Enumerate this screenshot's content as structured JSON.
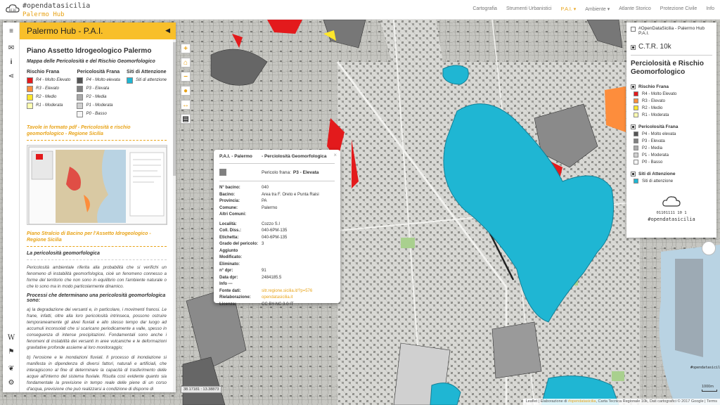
{
  "brand": {
    "line1": "#opendatasicilia",
    "line2": "Palermo Hub"
  },
  "nav": [
    {
      "label": "Cartografia",
      "active": false
    },
    {
      "label": "Strumenti Urbanistici",
      "active": false
    },
    {
      "label": "P.A.I. ▾",
      "active": true
    },
    {
      "label": "Ambiente ▾",
      "active": false
    },
    {
      "label": "Atlante Storico",
      "active": false
    },
    {
      "label": "Protezione Civile",
      "active": false
    },
    {
      "label": "Info",
      "active": false
    }
  ],
  "sidebar": {
    "title": "Palermo Hub - P.A.I.",
    "heading": "Piano Assetto Idrogeologico Palermo",
    "subheading": "Mappa delle Pericolosità e del Rischio Geomorfologico",
    "legend": {
      "rischio": {
        "title": "Rischio Frana",
        "items": [
          {
            "label": "R4 - Molto Elevato",
            "color": "#e31a1c"
          },
          {
            "label": "R3 - Elevato",
            "color": "#fd8d3c"
          },
          {
            "label": "R2 - Medio",
            "color": "#fee62b"
          },
          {
            "label": "R1 - Moderata",
            "color": "#ffffb2"
          }
        ]
      },
      "pericolosita": {
        "title": "Pericolosità Frana",
        "items": [
          {
            "label": "P4 - Molto elevata",
            "color": "#555555"
          },
          {
            "label": "P3 - Elevata",
            "color": "#808080"
          },
          {
            "label": "P2 - Media",
            "color": "#aaaaaa"
          },
          {
            "label": "P1 - Moderata",
            "color": "#d0d0d0"
          },
          {
            "label": "P0 - Basso",
            "color": "#f5f5f5"
          }
        ]
      },
      "siti": {
        "title": "Siti di Attenzione",
        "items": [
          {
            "label": "Siti di attenzione",
            "color": "#1fb6d3"
          }
        ]
      }
    },
    "tavole_link": "Tavole in formato pdf - Pericolosità e rischio geomorfologico - Regione Sicilia",
    "piano_link": "Piano Stralcio di Bacino per l'Assetto Idrogeologico - Regione Sicilia",
    "section_title": "La pericolosità geomorfologica",
    "para1": "Pericolosità ambientale riferita alla probabilità che si verifichi un fenomeno di instabilità geomorfologica, cioè un fenomeno connesso a forme del territorio che non sono in equilibrio con l'ambiente naturale o che lo sono ma in modo particolarmente dinamico.",
    "processes_title": "Processi che determinano una pericolosità geomorfologica sono:",
    "para2": "a) la degradazione dei versanti e, in particolare, i movimenti franosi. Le frane, infatti, oltre alla loro pericolosità intrinseca, possono ostruire temporaneamente gli alvei fluviali e allo stesso tempo dar luogo ad accumuli inconsolati che si scaricano periodicamente a valle, spesso in conseguenza di intense precipitazioni. Fondamentali sono anche i fenomeni di instabilità dei versanti in aree vulcaniche e le deformazioni gravitative profonde assieme al loro monitoraggio;",
    "para3": "b) l'erosione e le inondazioni fluviali. Il processo di inondazione si manifesta in dipendenza di diversi fattori, naturali e artificiali, che interagiscono al fine di determinare la capacità di trasferimento delle acque all'interno del sistema fluviale. Risulta così evidente quanto sia fondamentale la previsione in tempo reale delle piene di un corso d'acqua, previsione che può realizzarsi a condizione di disporre di"
  },
  "popup": {
    "col1": "P.A.I. - Palermo",
    "col2": "- Perciolosità Geomorfologica",
    "class_label": "Pericolo frana:",
    "class_value": "P3 - Elevata",
    "class_color": "#808080",
    "rows1": [
      {
        "k": "N° bacino:",
        "v": "040"
      },
      {
        "k": "Bacino:",
        "v": "Area tra F. Oreto e Punta Raisi"
      },
      {
        "k": "Provincia:",
        "v": "PA"
      },
      {
        "k": "Comune:",
        "v": "Palermo"
      },
      {
        "k": "Altri Comuni:",
        "v": ""
      }
    ],
    "rows2": [
      {
        "k": "Località:",
        "v": "Cozzo S.I"
      },
      {
        "k": "Coll. Diss.:",
        "v": "040-6PM-135"
      },
      {
        "k": "Etichetta:",
        "v": "040-6PM-135"
      },
      {
        "k": "Grado del pericolo:",
        "v": "3"
      },
      {
        "k": "Aggiunto",
        "v": ""
      },
      {
        "k": "Modificato:",
        "v": ""
      },
      {
        "k": "Eliminato:",
        "v": ""
      },
      {
        "k": "n° dpr:",
        "v": "91"
      },
      {
        "k": "Data dpr:",
        "v": "2484185.5"
      },
      {
        "k": "Info ---",
        "v": ""
      },
      {
        "k": "Fonte dati:",
        "v": "sitr.regione.sicilia.it/?p=576",
        "link": true
      },
      {
        "k": "Rielaborazione:",
        "v": "opendatasicilia.it",
        "link": true
      },
      {
        "k": "Licenza:",
        "v": "CC BY-NC 3.0 IT"
      }
    ]
  },
  "layers": {
    "top": "#OpenDataSicilia - Palermo Hub P.A.I.",
    "ctr": "C.T.R. 10k",
    "title": "Perciolosità e Rischio Geomorfologico",
    "groups": [
      {
        "name": "Rischio Frana",
        "items": [
          {
            "label": "R4 - Molto Elevato",
            "color": "#e31a1c"
          },
          {
            "label": "R3 - Elevato",
            "color": "#fd8d3c"
          },
          {
            "label": "R2 - Medio",
            "color": "#fee62b"
          },
          {
            "label": "R1 - Moderata",
            "color": "#ffffb2"
          }
        ]
      },
      {
        "name": "Pericolosità Frana",
        "items": [
          {
            "label": "P4 - Molto elevata",
            "color": "#555555"
          },
          {
            "label": "P3 - Elevata",
            "color": "#808080"
          },
          {
            "label": "P2 - Media",
            "color": "#aaaaaa"
          },
          {
            "label": "P1 - Moderata",
            "color": "#d0d0d0"
          },
          {
            "label": "P0 - Basso",
            "color": "#f5f5f5"
          }
        ]
      },
      {
        "name": "Siti di Attenzione",
        "items": [
          {
            "label": "Siti di attenzione",
            "color": "#1fb6d3"
          }
        ]
      }
    ],
    "logo_bits": "01101111 10 1",
    "logo_tag": "#opendatasicilia"
  },
  "map": {
    "coords": "38.17181 : 13.38873",
    "scale": "1000m",
    "attribution_prefix": "Leaflet | ",
    "attribution_mid": "Elaborazione di ",
    "attribution_brand": "#opendatasicilia",
    "attribution_rest": ", Carta Tecnica Regionale 10k, Dati cartografici © 2017 Google | Terms"
  }
}
